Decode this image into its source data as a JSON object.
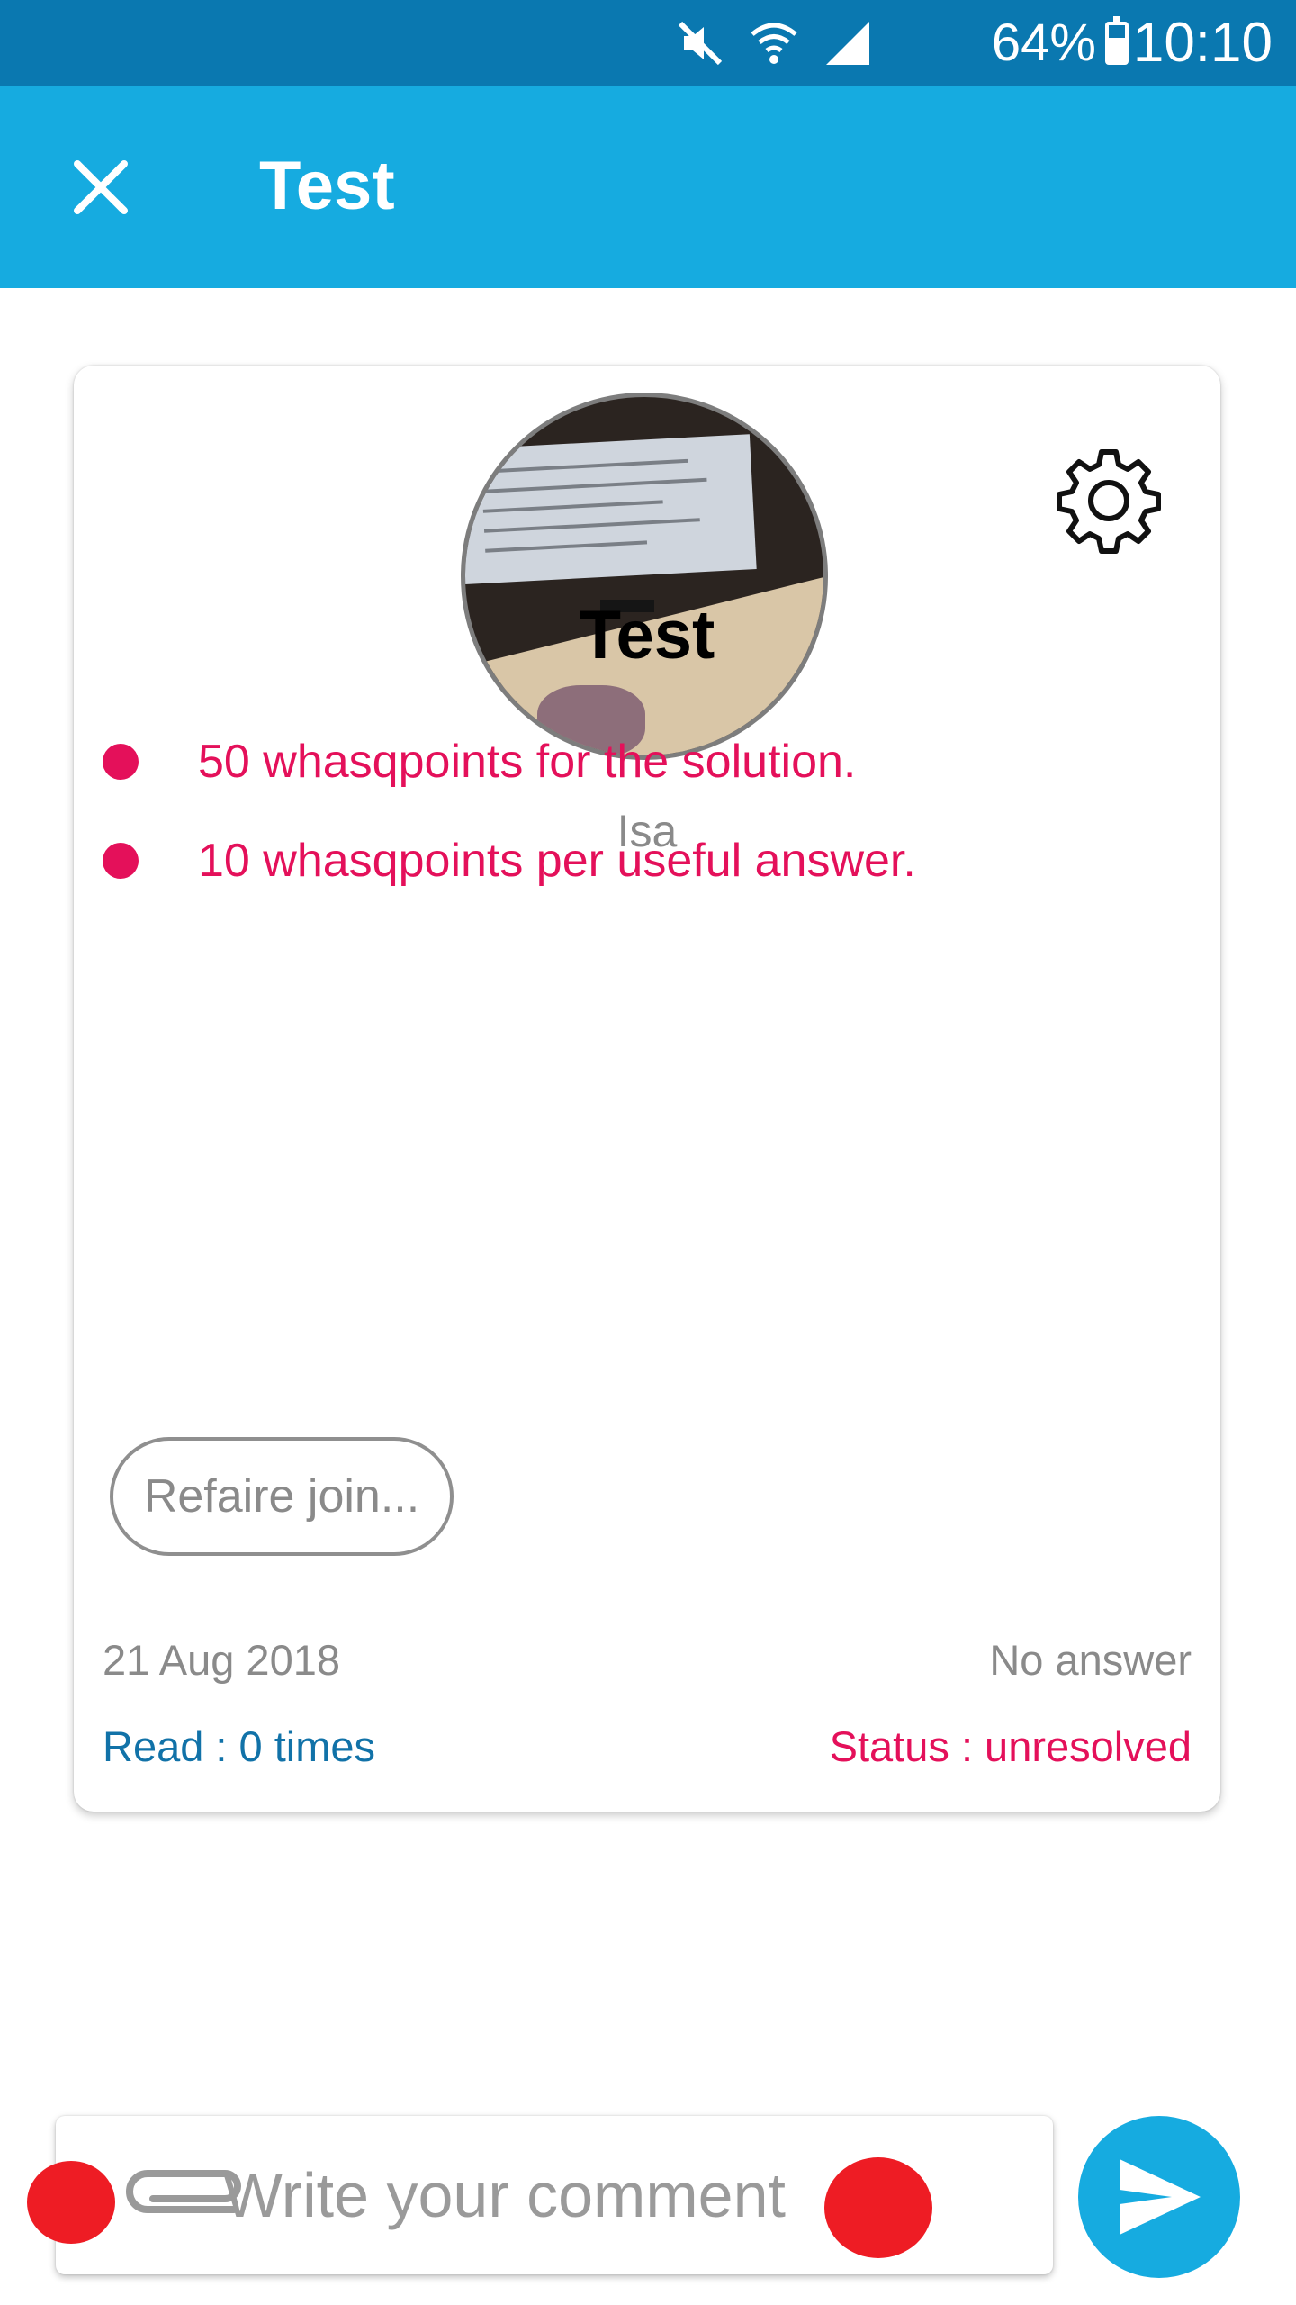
{
  "status_bar": {
    "battery_percent": "64%",
    "time": "10:10",
    "battery_level": 0.64,
    "icons": [
      "mute-icon",
      "wifi-icon",
      "signal-icon",
      "battery-icon"
    ]
  },
  "app_bar": {
    "title": "Test",
    "close_icon": "close-icon",
    "background": "#16ABE0"
  },
  "question": {
    "author": "Isa",
    "title": "Test",
    "rewards": [
      "50 whasqpoints for the solution.",
      "10 whasqpoints per useful answer."
    ],
    "attachment_chip": "Refaire join...",
    "date": "21 Aug 2018",
    "answers": "No answer",
    "read_count": "Read : 0 times",
    "status": "Status : unresolved",
    "settings_icon": "gear-icon"
  },
  "comment": {
    "placeholder": "Write your comment",
    "attach_icon": "paperclip-icon",
    "send_icon": "send-icon"
  },
  "colors": {
    "status_bar": "#0A78B0",
    "accent": "#16ABE0",
    "pink": "#E4105A",
    "link_blue": "#1172A8",
    "marker_red": "#EE1C24"
  }
}
